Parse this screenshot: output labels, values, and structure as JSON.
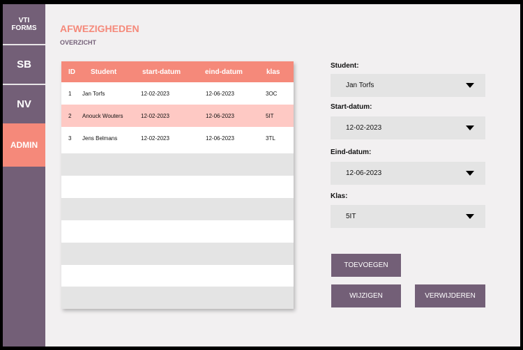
{
  "sidebar": {
    "brand_line1": "VTI",
    "brand_line2": "FORMS",
    "items": [
      {
        "label": "SB"
      },
      {
        "label": "NV"
      },
      {
        "label": "ADMIN"
      }
    ]
  },
  "header": {
    "title": "AFWEZIGHEDEN",
    "subtitle": "OVERZICHT"
  },
  "table": {
    "columns": [
      "ID",
      "Student",
      "start-datum",
      "eind-datum",
      "klas"
    ],
    "rows": [
      {
        "id": "1",
        "student": "Jan Torfs",
        "start": "12-02-2023",
        "end": "12-06-2023",
        "klas": "3OC"
      },
      {
        "id": "2",
        "student": "Anouck Wouters",
        "start": "12-02-2023",
        "end": "12-06-2023",
        "klas": "5IT"
      },
      {
        "id": "3",
        "student": "Jens Belmans",
        "start": "12-02-2023",
        "end": "12-06-2023",
        "klas": "3TL"
      }
    ],
    "selected_row": 2
  },
  "form": {
    "student_label": "Student:",
    "student_value": "Jan Torfs",
    "start_label": "Start-datum:",
    "start_value": "12-02-2023",
    "end_label": "Eind-datum:",
    "end_value": "12-06-2023",
    "klas_label": "Klas:",
    "klas_value": "5IT"
  },
  "buttons": {
    "add": "TOEVOEGEN",
    "edit": "WIJZIGEN",
    "delete": "VERWIJDEREN"
  },
  "colors": {
    "sidebar": "#735f77",
    "accent": "#f5897a",
    "selected_row": "#fec9c4",
    "background": "#f2f0f1"
  }
}
